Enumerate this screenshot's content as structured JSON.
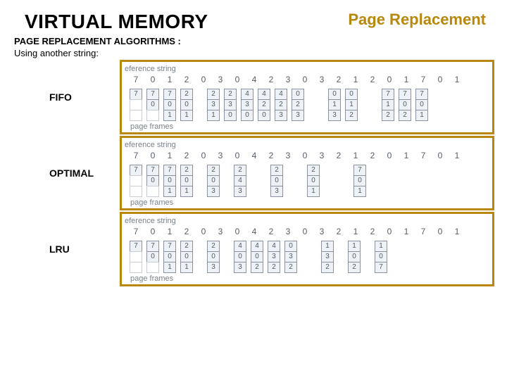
{
  "header": {
    "title": "VIRTUAL MEMORY",
    "topic": "Page Replacement",
    "subtitle": "PAGE REPLACEMENT ALGORITHMS :",
    "subline": "Using another string:"
  },
  "labels": {
    "fifo": "FIFO",
    "optimal": "OPTIMAL",
    "lru": "LRU",
    "ref_string": "eference string",
    "page_frames": "page frames"
  },
  "ref_string": [
    "7",
    "0",
    "1",
    "2",
    "0",
    "3",
    "0",
    "4",
    "2",
    "3",
    "0",
    "3",
    "2",
    "1",
    "2",
    "0",
    "1",
    "7",
    "0",
    "1"
  ],
  "fifo_cols": [
    [
      "7"
    ],
    [
      "7",
      "0"
    ],
    [
      "7",
      "0",
      "1"
    ],
    [
      "2",
      "0",
      "1"
    ],
    null,
    [
      "2",
      "3",
      "1"
    ],
    [
      "2",
      "3",
      "0"
    ],
    [
      "4",
      "3",
      "0"
    ],
    [
      "4",
      "2",
      "0"
    ],
    [
      "4",
      "2",
      "3"
    ],
    [
      "0",
      "2",
      "3"
    ],
    null,
    null,
    [
      "0",
      "1",
      "3"
    ],
    [
      "0",
      "1",
      "2"
    ],
    null,
    null,
    [
      "7",
      "1",
      "2"
    ],
    [
      "7",
      "0",
      "2"
    ],
    [
      "7",
      "0",
      "1"
    ]
  ],
  "optimal_cols": [
    [
      "7"
    ],
    [
      "7",
      "0"
    ],
    [
      "7",
      "0",
      "1"
    ],
    [
      "2",
      "0",
      "1"
    ],
    null,
    [
      "2",
      "0",
      "3"
    ],
    null,
    [
      "2",
      "4",
      "3"
    ],
    null,
    null,
    [
      "2",
      "0",
      "3"
    ],
    null,
    null,
    [
      "2",
      "0",
      "1"
    ],
    null,
    null,
    null,
    [
      "7",
      "0",
      "1"
    ],
    null,
    null
  ],
  "lru_cols": [
    [
      "7"
    ],
    [
      "7",
      "0"
    ],
    [
      "7",
      "0",
      "1"
    ],
    [
      "2",
      "0",
      "1"
    ],
    null,
    [
      "2",
      "0",
      "3"
    ],
    null,
    [
      "4",
      "0",
      "3"
    ],
    [
      "4",
      "0",
      "2"
    ],
    [
      "4",
      "3",
      "2"
    ],
    [
      "0",
      "3",
      "2"
    ],
    null,
    null,
    [
      "1",
      "3",
      "2"
    ],
    null,
    [
      "1",
      "0",
      "2"
    ],
    null,
    [
      "1",
      "0",
      "7"
    ],
    null,
    null
  ]
}
